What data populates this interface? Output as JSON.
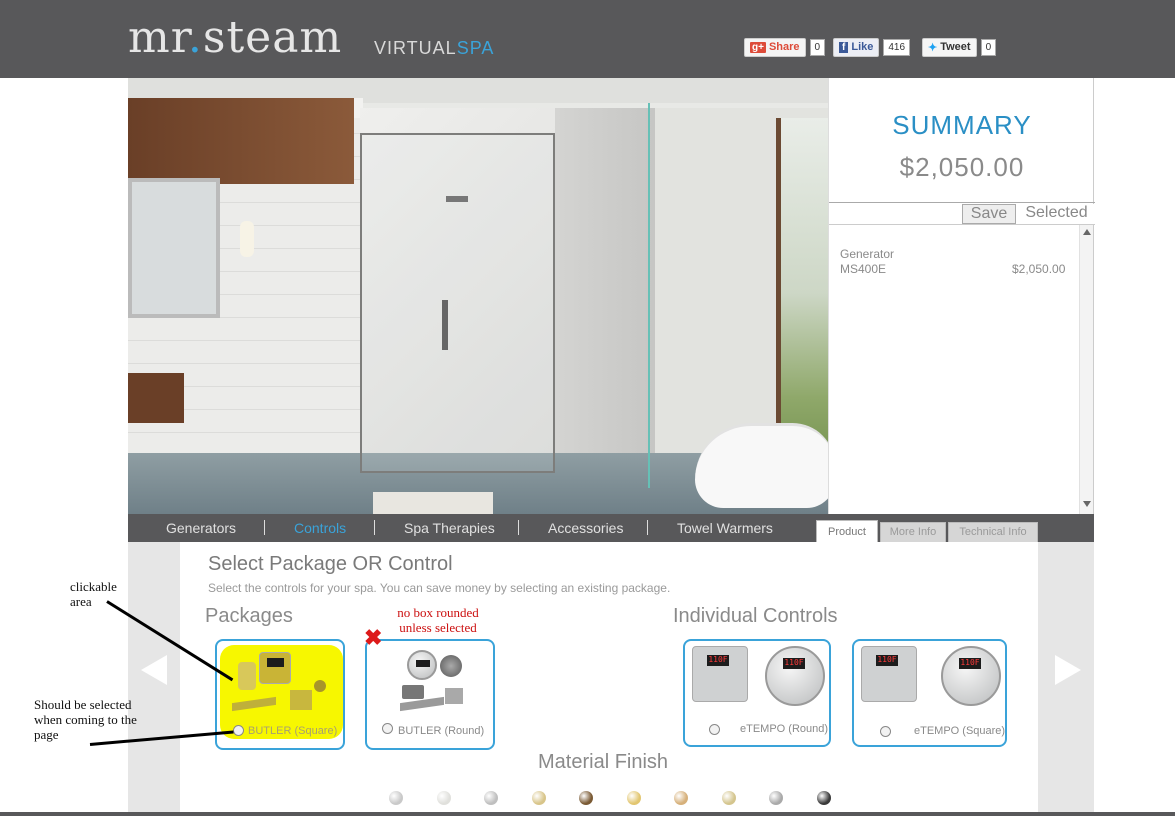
{
  "brand": {
    "name_left": "mr",
    "name_dot": ".",
    "name_right": "steam",
    "sub_left": "VIRTUAL",
    "sub_right": "SPA"
  },
  "social": {
    "gplus_label": "Share",
    "gplus_glyph": "g+",
    "gplus_count": "0",
    "fb_label": "Like",
    "fb_glyph": "f",
    "fb_count": "416",
    "tw_label": "Tweet",
    "tw_count": "0"
  },
  "summary": {
    "title": "SUMMARY",
    "total": "$2,050.00",
    "save_label": "Save",
    "selected_label": "Selected",
    "items": [
      {
        "category": "Generator",
        "name": "MS400E",
        "price": "$2,050.00"
      }
    ]
  },
  "nav": {
    "items": [
      {
        "label": "Generators",
        "active": false
      },
      {
        "label": "Controls",
        "active": true
      },
      {
        "label": "Spa Therapies",
        "active": false
      },
      {
        "label": "Accessories",
        "active": false
      },
      {
        "label": "Towel Warmers",
        "active": false
      }
    ],
    "accent_color": "#3aa3d9",
    "product_tabs": [
      "Product",
      "More Info",
      "Technical Info"
    ]
  },
  "content": {
    "heading": "Select Package OR Control",
    "subheading": "Select the controls for your spa. You can save money by selecting an existing package.",
    "packages_title": "Packages",
    "controls_title": "Individual Controls",
    "packages": [
      {
        "label": "BUTLER (Square)",
        "highlighted": true
      },
      {
        "label": "BUTLER (Round)",
        "highlighted": false
      }
    ],
    "controls": [
      {
        "label": "eTEMPO (Round)",
        "display": "110F"
      },
      {
        "label": "eTEMPO (Square)",
        "display": "110F"
      }
    ],
    "material_title": "Material Finish",
    "finishes": [
      "#c9c9c9",
      "#e0e0dc",
      "#bfbfbf",
      "#d8c58a",
      "#7a5a34",
      "#e2c670",
      "#d6b07a",
      "#d4c58e",
      "#a9a9a9",
      "#3a3a3a"
    ]
  },
  "annotations": {
    "clickable": "clickable\narea",
    "no_box_line1": "no box rounded",
    "no_box_line2": "unless selected",
    "selected_line1": "Should be selected",
    "selected_line2": "when coming to the",
    "selected_line3": "page"
  }
}
